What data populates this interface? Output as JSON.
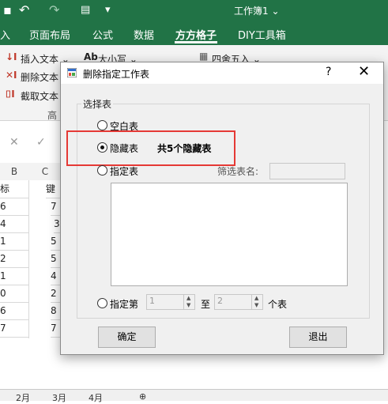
{
  "excel": {
    "window_title": "工作簿1 ⌄",
    "quick_access": {
      "undo": "↶",
      "redo": "↷",
      "dropdown": "▾"
    },
    "tabs": [
      "入",
      "页面布局",
      "公式",
      "数据",
      "方方格子",
      "DIY工具箱"
    ],
    "active_tab": "方方格子",
    "ribbon": {
      "insert_text": "插入文本 ⌄",
      "delete_text": "删除文本",
      "extract_text": "截取文本",
      "case": "大小写 ⌄",
      "round": "四舍五入 ⌄",
      "group_label": "高"
    },
    "formula_bar": {
      "cancel": "✕",
      "confirm": "✓"
    },
    "col_headers": [
      "B",
      "C"
    ],
    "col_b": [
      "标",
      "6",
      "4",
      "1",
      "2",
      "1",
      "0",
      "6",
      "7"
    ],
    "col_c": [
      "键",
      "7",
      "3",
      "5",
      "5",
      "4",
      "2",
      "8",
      "7"
    ],
    "sheet_tabs": [
      "2月",
      "3月",
      "4月",
      "⊕"
    ]
  },
  "dialog": {
    "title": "删除指定工作表",
    "help": "?",
    "close": "✕",
    "group_label": "选择表",
    "options": {
      "blank": "空白表",
      "hidden": "隐藏表",
      "hidden_count": "共5个隐藏表",
      "specified": "指定表",
      "filter_label": "筛选表名:",
      "filter_value": "",
      "range_prefix": "指定第",
      "range_from": "1",
      "range_mid": "至",
      "range_to": "2",
      "range_suffix": "个表"
    },
    "selected_option": "hidden",
    "ok_button": "确定",
    "exit_button": "退出"
  }
}
